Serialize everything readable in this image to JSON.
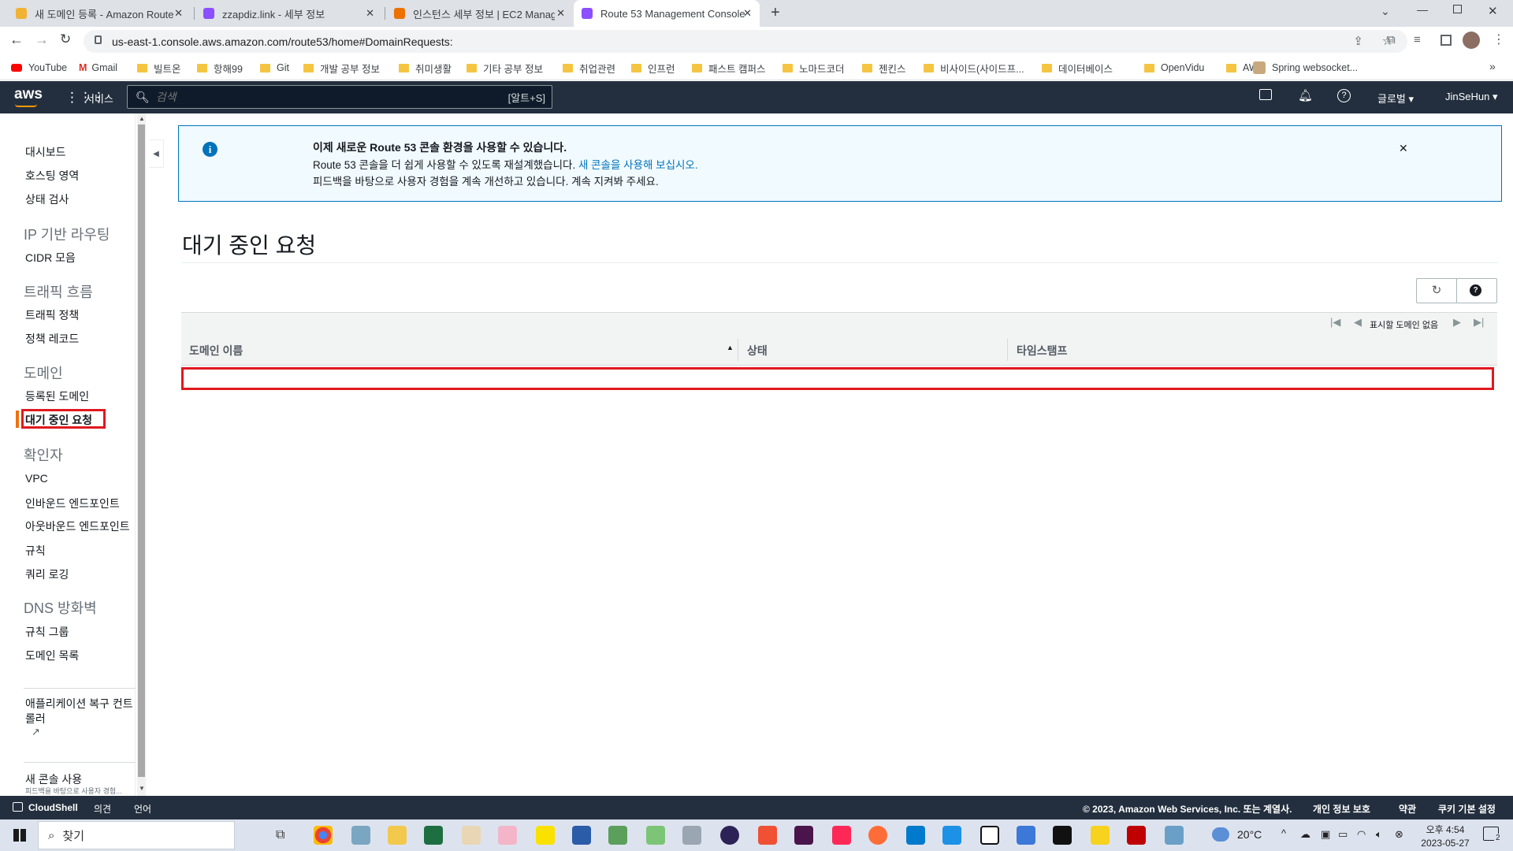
{
  "browser": {
    "tabs": [
      {
        "title": "새 도메인 등록 - Amazon Route",
        "active": false,
        "favicon_color": "#f2b233"
      },
      {
        "title": "zzapdiz.link - 세부 정보",
        "active": false,
        "favicon_color": "#8c4fff"
      },
      {
        "title": "인스턴스 세부 정보 | EC2 Manag",
        "active": false,
        "favicon_color": "#ed7100"
      },
      {
        "title": "Route 53 Management Console",
        "active": true,
        "favicon_color": "#8c4fff"
      }
    ],
    "url": "us-east-1.console.aws.amazon.com/route53/home#DomainRequests:",
    "bookmarks": [
      "YouTube",
      "Gmail",
      "빌트온",
      "항해99",
      "Git",
      "개발 공부 정보",
      "취미생활",
      "기타 공부 정보",
      "취업관련",
      "인프런",
      "패스트 캠퍼스",
      "노마드코더",
      "젠킨스",
      "비사이드(사이드프...",
      "데이터베이스",
      "OpenVidu",
      "AWS",
      "Spring websocket..."
    ]
  },
  "aws_nav": {
    "logo": "aws",
    "services_label": "서비스",
    "search_placeholder": "검색",
    "search_shortcut": "[알트+S]",
    "region_label": "글로벌",
    "user_label": "JinSeHun"
  },
  "sidebar": {
    "items": [
      {
        "type": "link",
        "label": "대시보드"
      },
      {
        "type": "link",
        "label": "호스팅 영역"
      },
      {
        "type": "link",
        "label": "상태 검사"
      },
      {
        "type": "heading",
        "label": "IP 기반 라우팅"
      },
      {
        "type": "link",
        "label": "CIDR 모음"
      },
      {
        "type": "heading",
        "label": "트래픽 흐름"
      },
      {
        "type": "link",
        "label": "트래픽 정책"
      },
      {
        "type": "link",
        "label": "정책 레코드"
      },
      {
        "type": "heading",
        "label": "도메인"
      },
      {
        "type": "link",
        "label": "등록된 도메인"
      },
      {
        "type": "link",
        "label": "대기 중인 요청",
        "active": true
      },
      {
        "type": "heading",
        "label": "확인자"
      },
      {
        "type": "link",
        "label": "VPC"
      },
      {
        "type": "link",
        "label": "인바운드 엔드포인트"
      },
      {
        "type": "link",
        "label": "아웃바운드 엔드포인트"
      },
      {
        "type": "link",
        "label": "규칙"
      },
      {
        "type": "link",
        "label": "쿼리 로깅"
      },
      {
        "type": "heading",
        "label": "DNS 방화벽"
      },
      {
        "type": "link",
        "label": "규칙 그룹"
      },
      {
        "type": "link",
        "label": "도메인 목록"
      }
    ],
    "arc_line1": "애플리케이션 복구 컨트",
    "arc_line2": "롤러",
    "new_console": "새 콘솔 사용",
    "new_console_sub": "피드백을 바탕으로 사용자 경험..."
  },
  "banner": {
    "title": "이제 새로운 Route 53 콘솔 환경을 사용할 수 있습니다.",
    "line1": "Route 53 콘솔을 더 쉽게 사용할 수 있도록 재설계했습니다.",
    "link": "새 콘솔을 사용해 보십시오.",
    "line2": "피드백을 바탕으로 사용자 경험을 계속 개선하고 있습니다. 계속 지켜봐 주세요."
  },
  "page": {
    "title": "대기 중인 요청",
    "pagination_text": "표시할 도메인 없음",
    "columns": [
      "도메인 이름",
      "상태",
      "타임스탬프"
    ],
    "rows": []
  },
  "footer": {
    "cloudshell": "CloudShell",
    "feedback": "의견",
    "language": "언어",
    "copyright": "© 2023, Amazon Web Services, Inc. 또는 계열사.",
    "privacy": "개인 정보 보호",
    "terms": "약관",
    "cookies": "쿠키 기본 설정"
  },
  "taskbar": {
    "search_label": "찾기",
    "weather": "20°C",
    "time": "오후 4:54",
    "date": "2023-05-27",
    "notification_count": "2"
  },
  "colors": {
    "aws_nav": "#232f3e",
    "accent_orange": "#ec7211",
    "link_blue": "#0073bb",
    "highlight_red": "#e0191f"
  }
}
